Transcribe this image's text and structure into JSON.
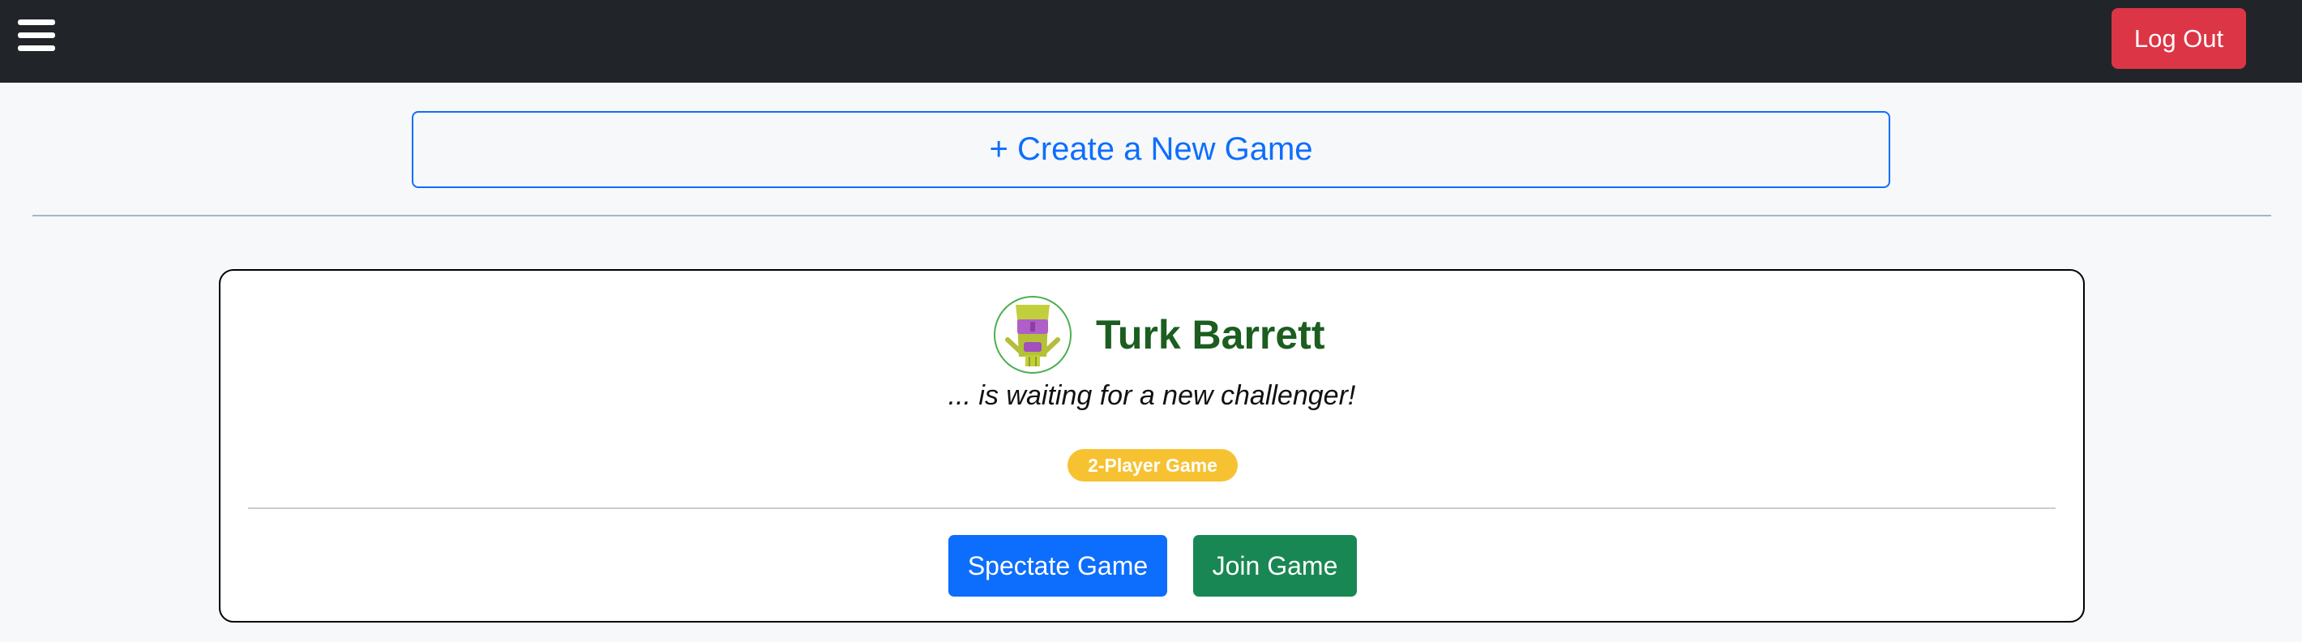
{
  "navbar": {
    "menu_icon": "hamburger-menu-icon",
    "logout_label": "Log Out"
  },
  "create_game": {
    "label": "+ Create a New Game"
  },
  "game_card": {
    "player_name": "Turk Barrett",
    "avatar_icon": "tiki-mask-avatar-icon",
    "waiting_text": "... is waiting for a new challenger!",
    "badge": "2-Player Game",
    "spectate_label": "Spectate Game",
    "join_label": "Join Game"
  },
  "colors": {
    "navbar_bg": "#212529",
    "logout_bg": "#dc3545",
    "primary": "#0d6efd",
    "success": "#198754",
    "badge_bg": "#f6c232",
    "player_name": "#1b5e20"
  }
}
